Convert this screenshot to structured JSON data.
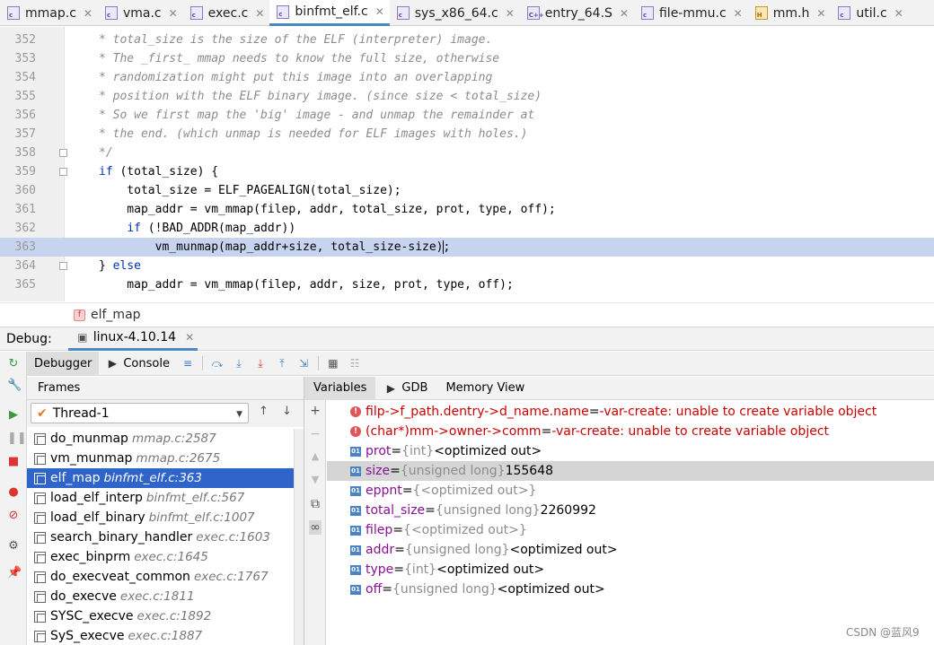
{
  "tabs": [
    {
      "label": "mmap.c",
      "icon": "c-file-icon",
      "active": false
    },
    {
      "label": "vma.c",
      "icon": "c-file-icon",
      "active": false
    },
    {
      "label": "exec.c",
      "icon": "c-file-icon",
      "active": false
    },
    {
      "label": "binfmt_elf.c",
      "icon": "c-file-icon",
      "active": true
    },
    {
      "label": "sys_x86_64.c",
      "icon": "c-file-icon",
      "active": false
    },
    {
      "label": "entry_64.S",
      "icon": "asm-file-icon",
      "active": false
    },
    {
      "label": "file-mmu.c",
      "icon": "c-file-icon",
      "active": false
    },
    {
      "label": "mm.h",
      "icon": "h-file-icon",
      "active": false
    },
    {
      "label": "util.c",
      "icon": "c-file-icon",
      "active": false
    }
  ],
  "editor": {
    "lines": [
      {
        "num": "352",
        "text": "* total_size is the size of the ELF (interpreter) image."
      },
      {
        "num": "353",
        "text": "* The _first_ mmap needs to know the full size, otherwise"
      },
      {
        "num": "354",
        "text": "* randomization might put this image into an overlapping"
      },
      {
        "num": "355",
        "text": "* position with the ELF binary image. (since size < total_size)"
      },
      {
        "num": "356",
        "text": "* So we first map the 'big' image - and unmap the remainder at"
      },
      {
        "num": "357",
        "text": "* the end. (which unmap is needed for ELF images with holes.)"
      },
      {
        "num": "358",
        "text": "*/"
      },
      {
        "num": "359",
        "pre": "",
        "kw": "if",
        "post": " (total_size) {"
      },
      {
        "num": "360",
        "text": "    total_size = ELF_PAGEALIGN(total_size);"
      },
      {
        "num": "361",
        "text": "    map_addr = vm_mmap(filep, addr, total_size, prot, type, off);"
      },
      {
        "num": "362",
        "pre": "    ",
        "kw": "if",
        "post": " (!BAD_ADDR(map_addr))"
      },
      {
        "num": "363",
        "text": "        vm_munmap(map_addr+size, total_size-size);"
      },
      {
        "num": "364",
        "pre": "} ",
        "kw": "else",
        "post": ""
      },
      {
        "num": "365",
        "text": "    map_addr = vm_mmap(filep, addr, size, prot, type, off);"
      }
    ],
    "highlighted_line": "363"
  },
  "breadcrumb": {
    "icon": "f",
    "label": "elf_map"
  },
  "debug": {
    "label": "Debug:",
    "session": "linux-4.10.14",
    "tabs": [
      "Debugger",
      "Console"
    ],
    "frames_header": "Frames",
    "thread": "Thread-1",
    "frames": [
      {
        "name": "do_munmap",
        "loc": "mmap.c:2587"
      },
      {
        "name": "vm_munmap",
        "loc": "mmap.c:2675"
      },
      {
        "name": "elf_map",
        "loc": "binfmt_elf.c:363"
      },
      {
        "name": "load_elf_interp",
        "loc": "binfmt_elf.c:567"
      },
      {
        "name": "load_elf_binary",
        "loc": "binfmt_elf.c:1007"
      },
      {
        "name": "search_binary_handler",
        "loc": "exec.c:1603"
      },
      {
        "name": "exec_binprm",
        "loc": "exec.c:1645"
      },
      {
        "name": "do_execveat_common",
        "loc": "exec.c:1767"
      },
      {
        "name": "do_execve",
        "loc": "exec.c:1811"
      },
      {
        "name": "SYSC_execve",
        "loc": "exec.c:1892"
      },
      {
        "name": "SyS_execve",
        "loc": "exec.c:1887"
      }
    ],
    "selected_frame": 2,
    "var_tabs": [
      "Variables",
      "GDB",
      "Memory View"
    ],
    "variables": [
      {
        "kind": "error",
        "name": "filp->f_path.dentry->d_name.name",
        "eq": " = ",
        "type": "",
        "value": "-var-create: unable to create variable object"
      },
      {
        "kind": "error",
        "name": "(char*)mm->owner->comm",
        "eq": " = ",
        "type": "",
        "value": "-var-create: unable to create variable object"
      },
      {
        "kind": "var",
        "name": "prot",
        "eq": " = ",
        "type": "{int}",
        "value": " <optimized out>"
      },
      {
        "kind": "var",
        "name": "size",
        "eq": " = ",
        "type": "{unsigned long}",
        "value": " 155648"
      },
      {
        "kind": "var",
        "name": "eppnt",
        "eq": " = ",
        "type": "{<optimized out>}",
        "value": ""
      },
      {
        "kind": "var",
        "name": "total_size",
        "eq": " = ",
        "type": "{unsigned long}",
        "value": " 2260992"
      },
      {
        "kind": "var",
        "name": "filep",
        "eq": " = ",
        "type": "{<optimized out>}",
        "value": ""
      },
      {
        "kind": "var",
        "name": "addr",
        "eq": " = ",
        "type": "{unsigned long}",
        "value": " <optimized out>"
      },
      {
        "kind": "var",
        "name": "type",
        "eq": " = ",
        "type": "{int}",
        "value": " <optimized out>"
      },
      {
        "kind": "var",
        "name": "off",
        "eq": " = ",
        "type": "{unsigned long}",
        "value": " <optimized out>"
      }
    ],
    "selected_variable": 3,
    "var_icon_label": "01"
  },
  "watermark": "CSDN @蓝风9",
  "colors": {
    "accent": "#2f65ca",
    "highlight_line": "#c6d4f0",
    "error": "#c00000",
    "keyword": "#0033b3"
  }
}
